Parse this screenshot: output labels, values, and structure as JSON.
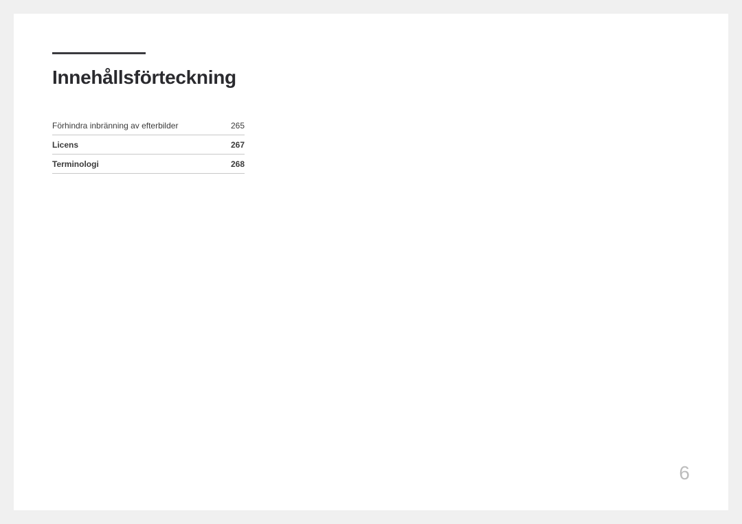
{
  "title": "Innehållsförteckning",
  "toc": [
    {
      "label": "Förhindra inbränning av efterbilder",
      "page": "265",
      "bold": false
    },
    {
      "label": "Licens",
      "page": "267",
      "bold": true
    },
    {
      "label": "Terminologi",
      "page": "268",
      "bold": true
    }
  ],
  "pageNumber": "6"
}
